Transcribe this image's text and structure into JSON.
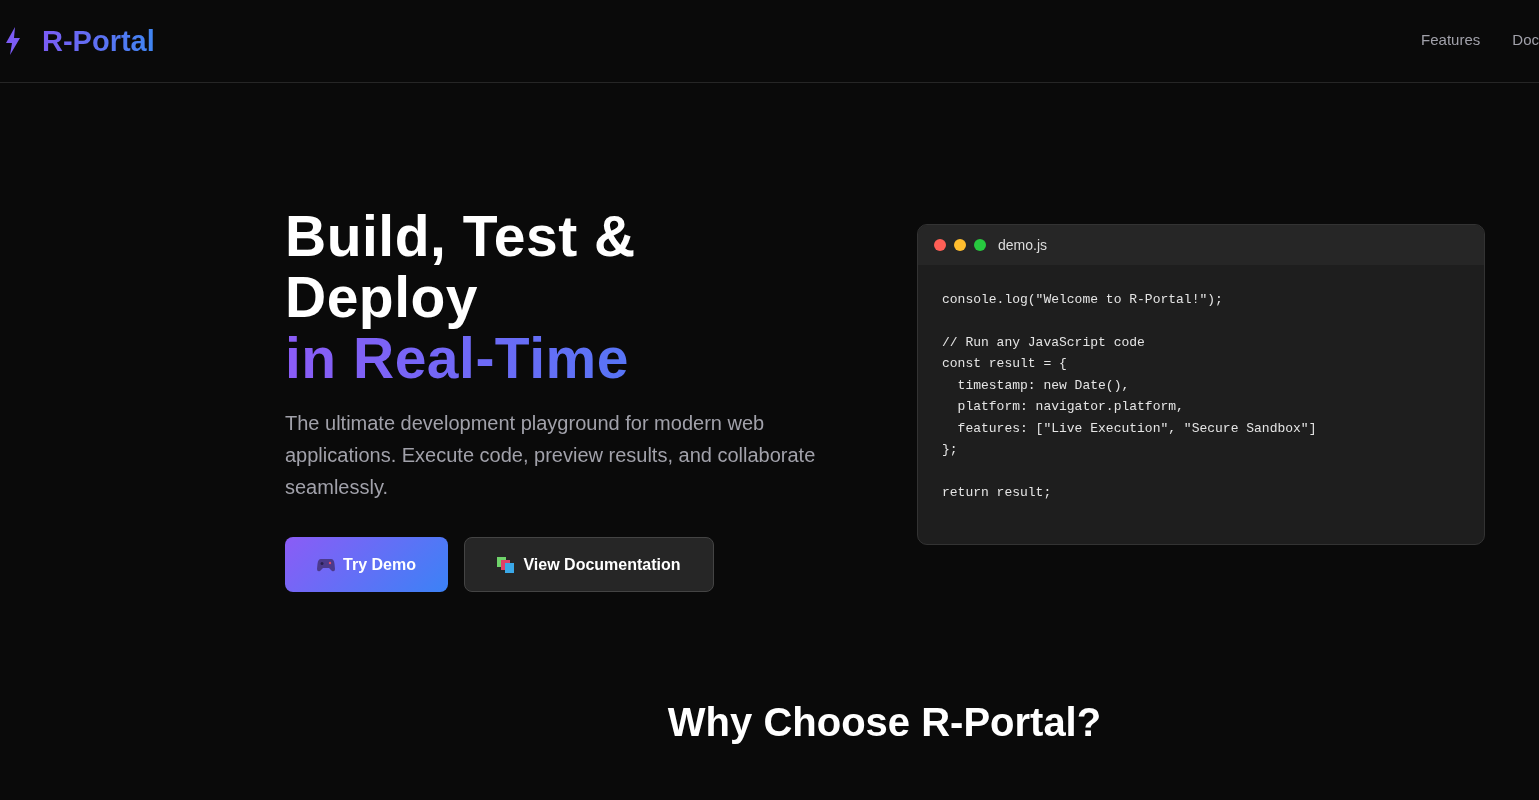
{
  "header": {
    "brand": "R-Portal",
    "nav": [
      {
        "label": "Features"
      },
      {
        "label": "Doc"
      }
    ]
  },
  "hero": {
    "title_lines": [
      "Build, Test &",
      "Deploy"
    ],
    "title_accent": "in Real-Time",
    "description": "The ultimate development playground for modern web applications. Execute code, preview results, and collaborate seamlessly.",
    "buttons": [
      {
        "kind": "primary",
        "label": "Try Demo"
      },
      {
        "kind": "secondary",
        "label": "View Documentation"
      }
    ]
  },
  "code_window": {
    "filename": "demo.js",
    "blocks": [
      [
        "console.log(\"Welcome to R-Portal!\");"
      ],
      [
        "// Run any JavaScript code",
        "const result = {",
        "  timestamp: new Date(),",
        "  platform: navigator.platform,",
        "  features: [\"Live Execution\", \"Secure Sandbox\"]",
        "};"
      ],
      [
        "return result;"
      ]
    ]
  },
  "section": {
    "heading": "Why Choose R-Portal?"
  }
}
